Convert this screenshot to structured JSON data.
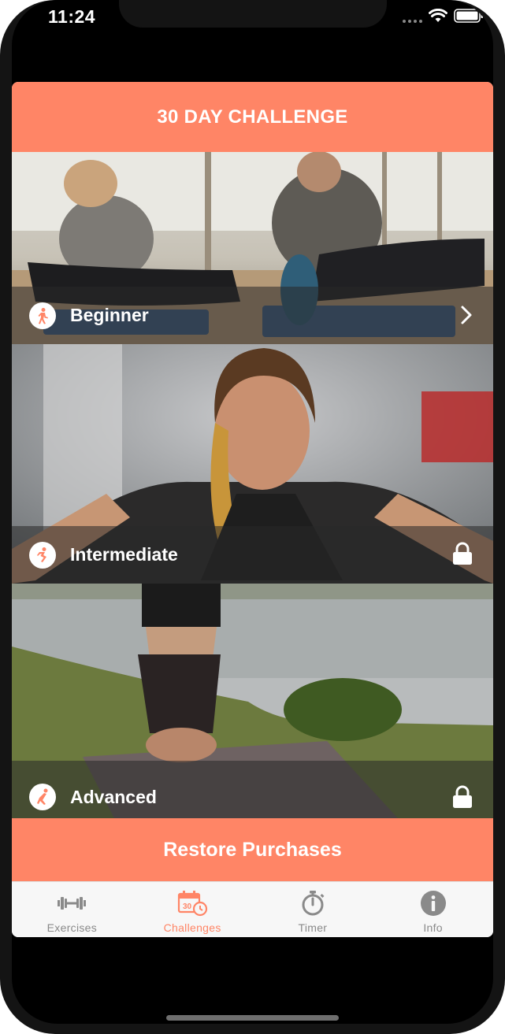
{
  "status_bar": {
    "time": "11:24"
  },
  "header": {
    "title": "30 DAY CHALLENGE"
  },
  "levels": [
    {
      "label": "Beginner",
      "icon": "walking-person-icon",
      "trailing": "chevron-right-icon"
    },
    {
      "label": "Intermediate",
      "icon": "running-person-icon",
      "trailing": "lock-icon"
    },
    {
      "label": "Advanced",
      "icon": "stretching-person-icon",
      "trailing": "lock-icon"
    }
  ],
  "restore_button": {
    "label": "Restore Purchases"
  },
  "tabs": [
    {
      "label": "Exercises",
      "icon": "dumbbell-icon"
    },
    {
      "label": "Challenges",
      "icon": "calendar-30-icon",
      "selected": true
    },
    {
      "label": "Timer",
      "icon": "stopwatch-icon"
    },
    {
      "label": "Info",
      "icon": "info-icon"
    }
  ],
  "colors": {
    "accent": "#ff8566",
    "tab_inactive": "#8a8a8a",
    "overlay": "#282828"
  }
}
